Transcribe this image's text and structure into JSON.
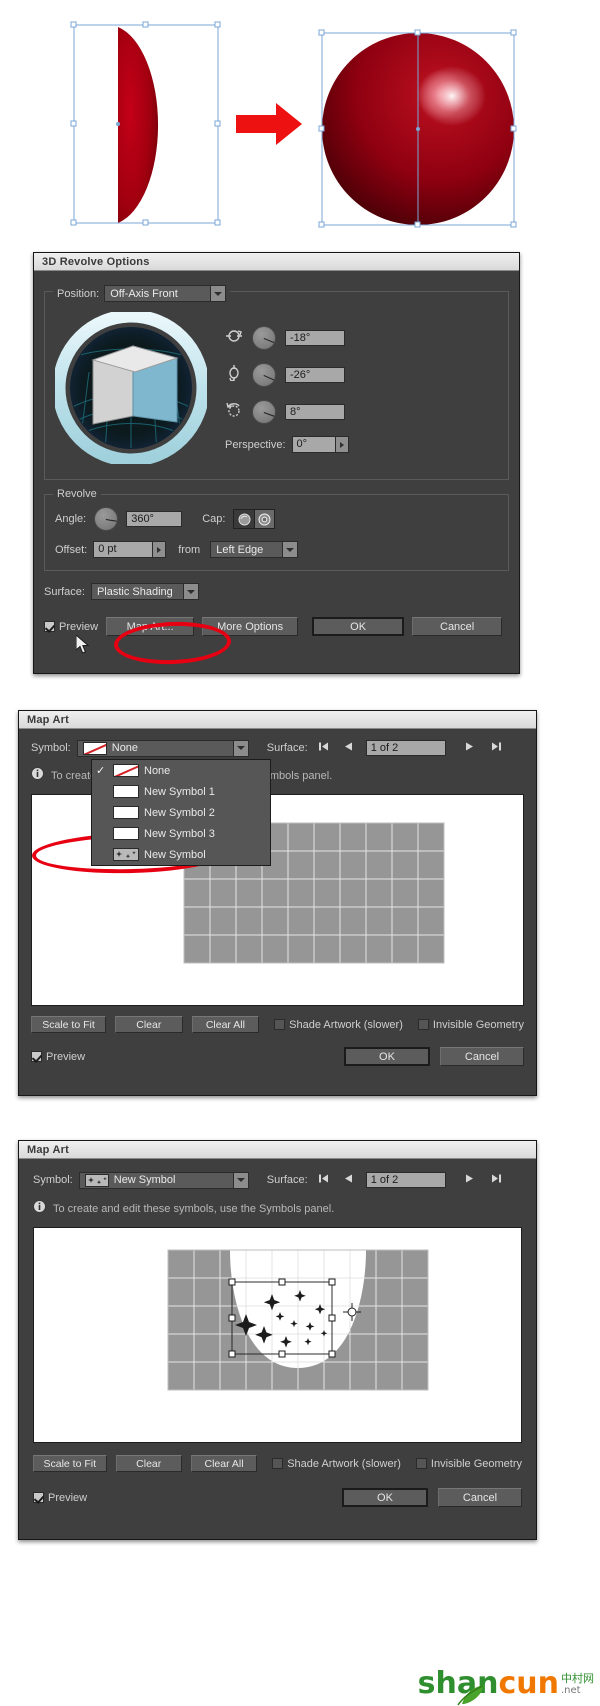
{
  "artwork": {
    "caption_left": "half-ellipse-path",
    "caption_right": "revolved-3d-sphere",
    "arrow": "red-right-arrow",
    "shape_fill": "#a5000f",
    "arrow_color": "#ee1111",
    "selection_color": "#7ba7d7"
  },
  "revolve_dialog": {
    "title": "3D Revolve Options",
    "position": {
      "label": "Position:",
      "value": "Off-Axis Front"
    },
    "rotation": {
      "x_icon": "rotate-x-axis-icon",
      "x_value": "-18°",
      "y_icon": "rotate-y-axis-icon",
      "y_value": "-26°",
      "z_icon": "rotate-z-axis-icon",
      "z_value": "8°",
      "perspective_label": "Perspective:",
      "perspective_value": "0°"
    },
    "revolve": {
      "legend": "Revolve",
      "angle_label": "Angle:",
      "angle_value": "360°",
      "cap_label": "Cap:",
      "cap_on_icon": "cap-on-icon",
      "cap_off_icon": "cap-off-icon",
      "offset_label": "Offset:",
      "offset_value": "0 pt",
      "from_label": "from",
      "from_value": "Left Edge"
    },
    "surface": {
      "label": "Surface:",
      "value": "Plastic Shading"
    },
    "footer": {
      "preview_label": "Preview",
      "preview_checked": true,
      "map_art": "Map Art...",
      "more_options": "More Options",
      "ok": "OK",
      "cancel": "Cancel"
    },
    "annotation": "red-ellipse-around-map-art"
  },
  "mapart_open": {
    "title": "Map Art",
    "symbol_label": "Symbol:",
    "symbol_value": "None",
    "symbol_swatch": "none-swatch-icon",
    "surface_label": "Surface:",
    "surface_value": "1 of 2",
    "nav": {
      "first": "first-surface-icon",
      "prev": "previous-surface-icon",
      "next": "next-surface-icon",
      "last": "last-surface-icon"
    },
    "info_icon": "info-icon",
    "info_text": "To create and edit these symbols, use the Symbols panel.",
    "dropdown": {
      "open": true,
      "items": [
        {
          "label": "None",
          "swatch": "none-swatch-icon",
          "checked": true
        },
        {
          "label": "New Symbol 1",
          "swatch": "blank-swatch-icon",
          "checked": false
        },
        {
          "label": "New Symbol 2",
          "swatch": "blank-swatch-icon",
          "checked": false
        },
        {
          "label": "New Symbol 3",
          "swatch": "blank-swatch-icon",
          "checked": false
        },
        {
          "label": "New Symbol",
          "swatch": "stars-swatch-icon",
          "checked": false
        }
      ],
      "annotation": "red-ellipse-around-new-symbol"
    },
    "toolbar": {
      "scale_to_fit": "Scale to Fit",
      "clear": "Clear",
      "clear_all": "Clear All",
      "shade_artwork": "Shade Artwork (slower)",
      "shade_artwork_checked": false,
      "invisible_geometry": "Invisible Geometry",
      "invisible_geometry_checked": false
    },
    "footer": {
      "preview_label": "Preview",
      "preview_checked": true,
      "ok": "OK",
      "cancel": "Cancel"
    }
  },
  "mapart_applied": {
    "title": "Map Art",
    "symbol_label": "Symbol:",
    "symbol_value": "New Symbol",
    "symbol_swatch": "stars-swatch-icon",
    "surface_label": "Surface:",
    "surface_value": "1 of 2",
    "nav": {
      "first": "first-surface-icon",
      "prev": "previous-surface-icon",
      "next": "next-surface-icon",
      "last": "last-surface-icon"
    },
    "info_icon": "info-icon",
    "info_text": "To create and edit these symbols, use the Symbols panel.",
    "canvas": {
      "selection": "stars-artwork-selection",
      "handles": 8
    },
    "toolbar": {
      "scale_to_fit": "Scale to Fit",
      "clear": "Clear",
      "clear_all": "Clear All",
      "shade_artwork": "Shade Artwork (slower)",
      "shade_artwork_checked": false,
      "invisible_geometry": "Invisible Geometry",
      "invisible_geometry_checked": false
    },
    "footer": {
      "preview_label": "Preview",
      "preview_checked": true,
      "ok": "OK",
      "cancel": "Cancel"
    }
  },
  "watermark": {
    "shan": "shan",
    "cun": "cun",
    "cn": "中村网",
    "net": ".net"
  }
}
